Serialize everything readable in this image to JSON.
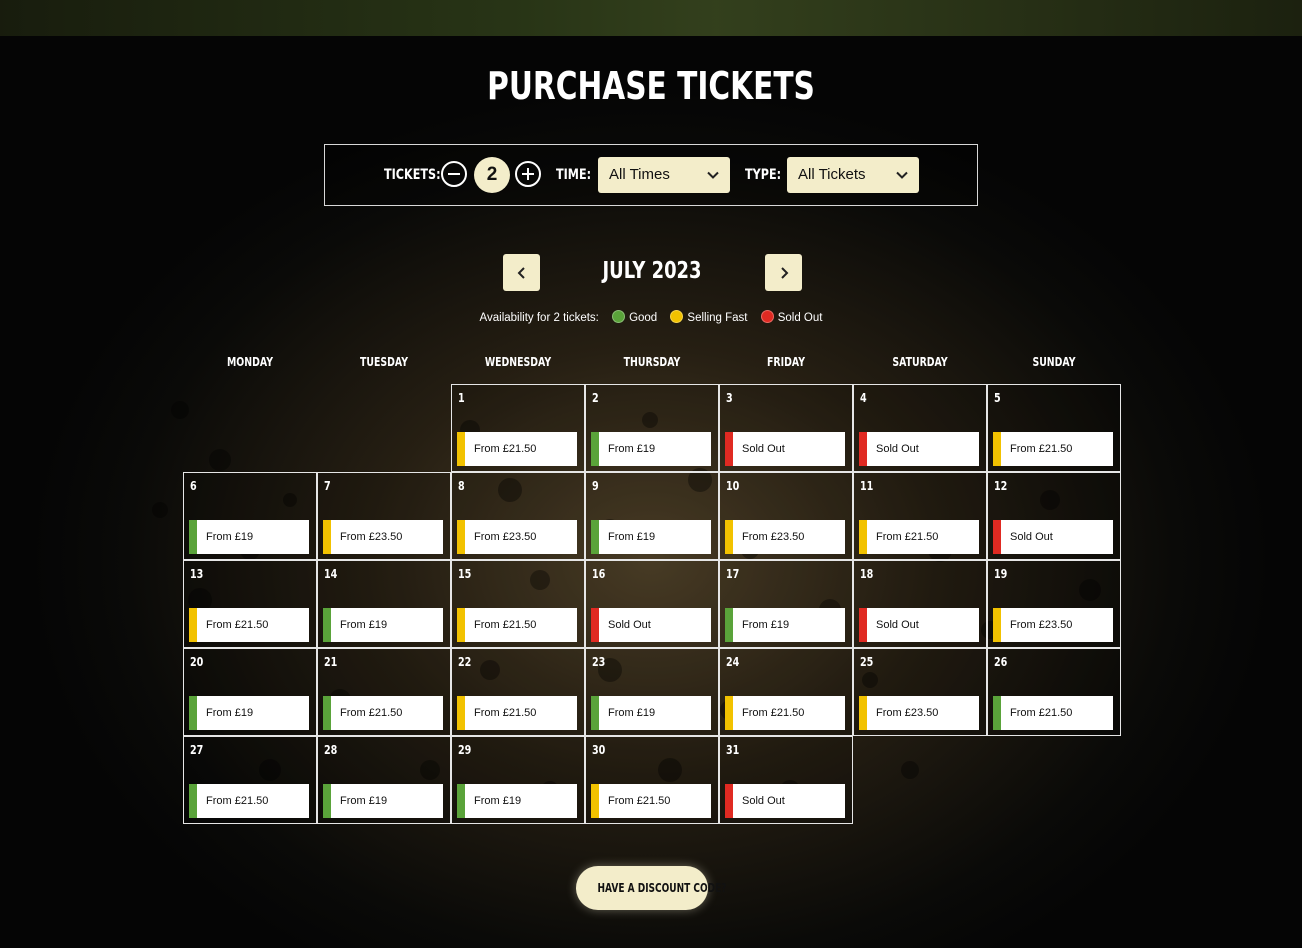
{
  "page": {
    "title": "PURCHASE TICKETS"
  },
  "filters": {
    "tickets_label": "TICKETS:",
    "ticket_count": "2",
    "time_label": "TIME:",
    "time_value": "All Times",
    "type_label": "TYPE:",
    "type_value": "All Tickets"
  },
  "calendar": {
    "month": "JULY 2023",
    "availability_label": "Availability for 2 tickets:",
    "legend": [
      {
        "label": "Good",
        "color": "#5aa33a"
      },
      {
        "label": "Selling Fast",
        "color": "#f2c200"
      },
      {
        "label": "Sold Out",
        "color": "#e02a22"
      }
    ],
    "weekdays": [
      "MONDAY",
      "TUESDAY",
      "WEDNESDAY",
      "THURSDAY",
      "FRIDAY",
      "SATURDAY",
      "SUNDAY"
    ],
    "first_weekday_index": 2,
    "status_colors": {
      "good": "#5aa33a",
      "fast": "#f2c200",
      "sold": "#e02a22"
    },
    "days": [
      {
        "day": "1",
        "text": "From £21.50",
        "status": "fast"
      },
      {
        "day": "2",
        "text": "From £19",
        "status": "good"
      },
      {
        "day": "3",
        "text": "Sold Out",
        "status": "sold"
      },
      {
        "day": "4",
        "text": "Sold Out",
        "status": "sold"
      },
      {
        "day": "5",
        "text": "From £21.50",
        "status": "fast"
      },
      {
        "day": "6",
        "text": "From £19",
        "status": "good"
      },
      {
        "day": "7",
        "text": "From £23.50",
        "status": "fast"
      },
      {
        "day": "8",
        "text": "From £23.50",
        "status": "fast"
      },
      {
        "day": "9",
        "text": "From £19",
        "status": "good"
      },
      {
        "day": "10",
        "text": "From £23.50",
        "status": "fast"
      },
      {
        "day": "11",
        "text": "From £21.50",
        "status": "fast"
      },
      {
        "day": "12",
        "text": "Sold Out",
        "status": "sold"
      },
      {
        "day": "13",
        "text": "From £21.50",
        "status": "fast"
      },
      {
        "day": "14",
        "text": "From £19",
        "status": "good"
      },
      {
        "day": "15",
        "text": "From £21.50",
        "status": "fast"
      },
      {
        "day": "16",
        "text": "Sold Out",
        "status": "sold"
      },
      {
        "day": "17",
        "text": "From £19",
        "status": "good"
      },
      {
        "day": "18",
        "text": "Sold Out",
        "status": "sold"
      },
      {
        "day": "19",
        "text": "From £23.50",
        "status": "fast"
      },
      {
        "day": "20",
        "text": "From £19",
        "status": "good"
      },
      {
        "day": "21",
        "text": "From £21.50",
        "status": "good"
      },
      {
        "day": "22",
        "text": "From £21.50",
        "status": "fast"
      },
      {
        "day": "23",
        "text": "From £19",
        "status": "good"
      },
      {
        "day": "24",
        "text": "From £21.50",
        "status": "fast"
      },
      {
        "day": "25",
        "text": "From £23.50",
        "status": "fast"
      },
      {
        "day": "26",
        "text": "From £21.50",
        "status": "good"
      },
      {
        "day": "27",
        "text": "From £21.50",
        "status": "good"
      },
      {
        "day": "28",
        "text": "From £19",
        "status": "good"
      },
      {
        "day": "29",
        "text": "From £19",
        "status": "good"
      },
      {
        "day": "30",
        "text": "From £21.50",
        "status": "fast"
      },
      {
        "day": "31",
        "text": "Sold Out",
        "status": "sold"
      }
    ]
  },
  "discount": {
    "label": "HAVE A DISCOUNT CODE?"
  }
}
